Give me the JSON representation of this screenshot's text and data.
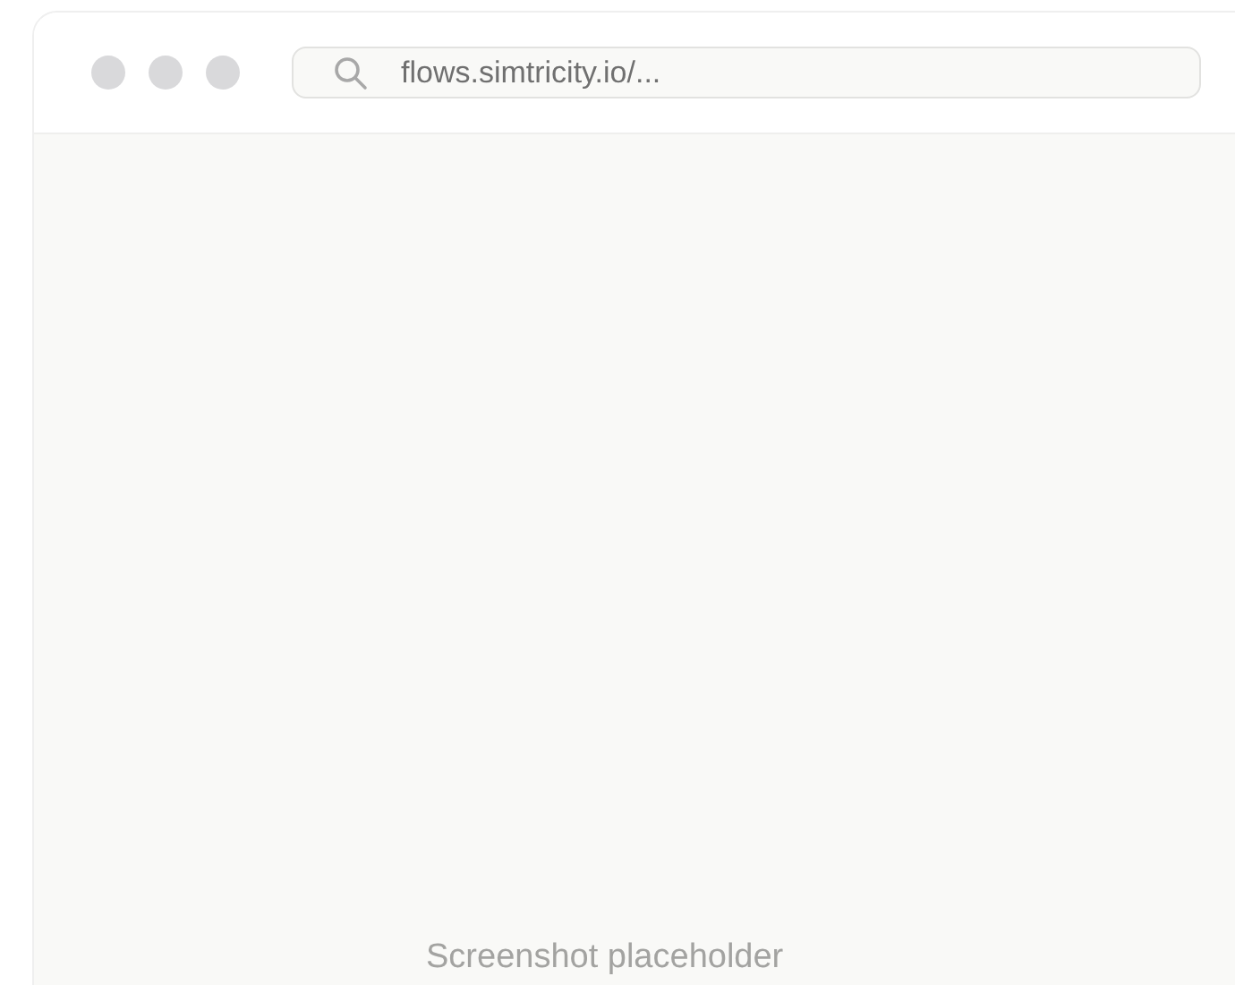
{
  "address_bar": {
    "url": "flows.simtricity.io/..."
  },
  "content": {
    "placeholder_text": "Screenshot placeholder"
  }
}
